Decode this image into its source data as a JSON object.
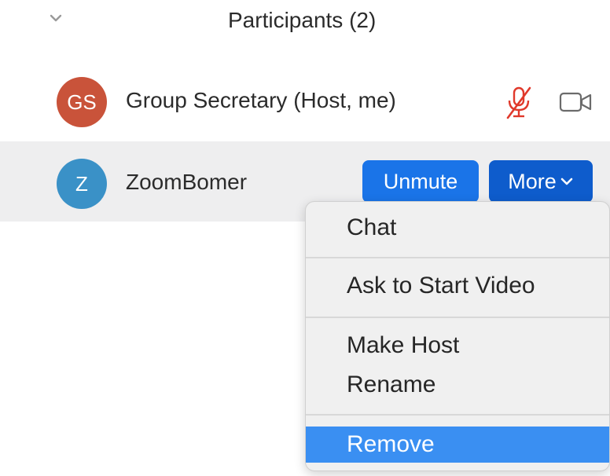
{
  "header": {
    "title": "Participants (2)"
  },
  "participants": [
    {
      "initials": "GS",
      "name": "Group Secretary (Host, me)",
      "avatar_color": "#c9533a"
    },
    {
      "initials": "Z",
      "name": "ZoomBomer",
      "avatar_color": "#3a91c7"
    }
  ],
  "buttons": {
    "unmute_label": "Unmute",
    "more_label": "More"
  },
  "menu": {
    "items": [
      "Chat",
      "Ask to Start Video",
      "Make Host",
      "Rename",
      "Remove"
    ],
    "highlighted": "Remove"
  },
  "colors": {
    "accent": "#1a74e8",
    "accent_dark": "#0e5ccc",
    "menu_highlight": "#3a8ff2",
    "muted_red": "#e0392b"
  },
  "icons": {
    "collapse": "chevron-down-icon",
    "mic": "microphone-muted-icon",
    "camera": "video-camera-icon"
  }
}
